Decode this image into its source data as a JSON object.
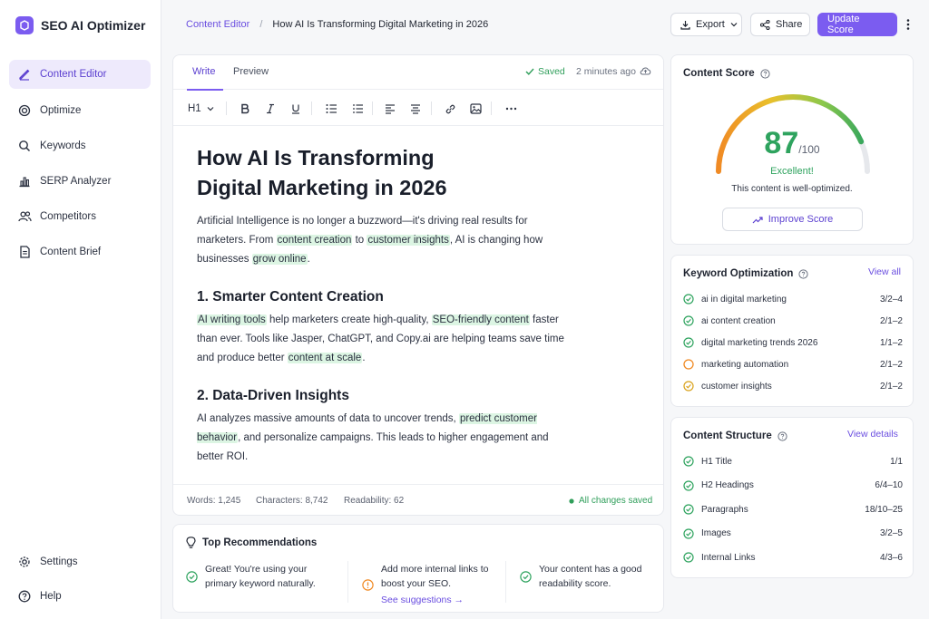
{
  "app": {
    "name": "SEO AI Optimizer"
  },
  "sidebar": {
    "items": [
      {
        "label": "Content Editor",
        "icon": "pencil-icon"
      },
      {
        "label": "Optimize",
        "icon": "target-icon"
      },
      {
        "label": "Keywords",
        "icon": "search-icon"
      },
      {
        "label": "SERP Analyzer",
        "icon": "bar-chart-icon"
      },
      {
        "label": "Competitors",
        "icon": "users-icon"
      },
      {
        "label": "Content Brief",
        "icon": "document-icon"
      }
    ],
    "bottom": [
      {
        "label": "Settings",
        "icon": "gear-icon"
      },
      {
        "label": "Help",
        "icon": "help-icon"
      }
    ]
  },
  "header": {
    "breadcrumb": [
      "Content Editor",
      "How AI Is Transforming Digital Marketing in 2026"
    ],
    "separator": "/",
    "export_label": "Export",
    "share_label": "Share",
    "update_label": "Update Score"
  },
  "editor": {
    "tabs": [
      "Write",
      "Preview"
    ],
    "saved_label": "Saved",
    "saved_time": "2 minutes ago",
    "heading_select": "H1",
    "title_line1": "How AI Is Transforming",
    "title_line2": "Digital Marketing in 2026",
    "p1": {
      "a": "Artificial Intelligence is no longer a buzzword—it's driving real results for marketers. From ",
      "h1": "content creation",
      "b": " to ",
      "h2": "customer insights",
      "c": ", AI is changing how businesses ",
      "h3": "grow online",
      "d": "."
    },
    "h2_1": "1. Smarter Content Creation",
    "p2": {
      "h1": "AI writing tools",
      "a": " help marketers create high-quality, ",
      "h2": "SEO-friendly content",
      "b": " faster than ever. Tools like Jasper, ChatGPT, and Copy.ai are helping teams save time and produce better ",
      "h3": "content at scale",
      "c": "."
    },
    "h2_2": "2. Data-Driven Insights",
    "p3": {
      "a": "AI analyzes massive amounts of data to uncover trends, ",
      "h1": "predict customer behavior",
      "b": ", and personalize campaigns. This leads to higher engagement and better ROI."
    },
    "stats": {
      "words": "Words: 1,245",
      "characters": "Characters: 8,742",
      "readability": "Readability: 62",
      "saved": "All changes saved"
    }
  },
  "recommendations": {
    "title": "Top Recommendations",
    "items": [
      {
        "text": "Great! You're using your primary keyword naturally.",
        "status": "good"
      },
      {
        "text": "Add more internal links to boost your SEO.",
        "status": "warning",
        "link": "See suggestions →"
      },
      {
        "text": "Your content has a good readability score.",
        "status": "good"
      }
    ]
  },
  "score": {
    "title": "Content Score",
    "value": "87",
    "max": "/100",
    "value_fraction": 0.87,
    "label": "Excellent!",
    "description": "This content is well-optimized.",
    "button": "Improve Score"
  },
  "keywords": {
    "title": "Keyword Optimization",
    "link": "View all",
    "items": [
      {
        "term": "ai in digital marketing",
        "count": "3/2–4",
        "status": "good"
      },
      {
        "term": "ai content creation",
        "count": "2/1–2",
        "status": "good"
      },
      {
        "term": "digital marketing trends 2026",
        "count": "1/1–2",
        "status": "good"
      },
      {
        "term": "marketing automation",
        "count": "2/1–2",
        "status": "warning"
      },
      {
        "term": "customer insights",
        "count": "2/1–2",
        "status": "partial"
      }
    ]
  },
  "structure": {
    "title": "Content Structure",
    "link": "View details",
    "items": [
      {
        "label": "H1 Title",
        "value": "1/1"
      },
      {
        "label": "H2 Headings",
        "value": "6/4–10"
      },
      {
        "label": "Paragraphs",
        "value": "18/10–25"
      },
      {
        "label": "Images",
        "value": "3/2–5"
      },
      {
        "label": "Internal Links",
        "value": "4/3–6"
      }
    ]
  },
  "colors": {
    "accent": "#7b5cf0",
    "good": "#2ea35e",
    "warning": "#f08a24",
    "partial": "#d9a21b"
  }
}
